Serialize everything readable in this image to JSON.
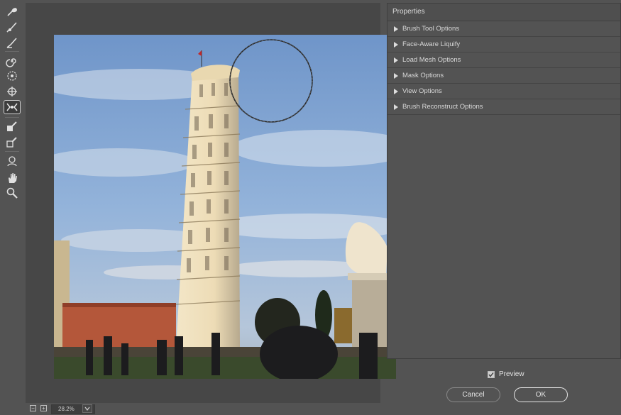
{
  "toolbar": {
    "tools": [
      {
        "name": "forward-warp-tool-icon"
      },
      {
        "name": "reconstruct-tool-icon"
      },
      {
        "name": "smooth-tool-icon"
      },
      {
        "name": "twirl-clockwise-tool-icon"
      },
      {
        "name": "pucker-tool-icon"
      },
      {
        "name": "bloat-tool-icon"
      },
      {
        "name": "push-left-tool-icon",
        "active": true
      },
      {
        "name": "freeze-mask-tool-icon"
      },
      {
        "name": "thaw-mask-tool-icon"
      },
      {
        "name": "face-tool-icon"
      },
      {
        "name": "hand-tool-icon"
      },
      {
        "name": "zoom-tool-icon"
      }
    ]
  },
  "properties": {
    "title": "Properties",
    "sections": [
      {
        "label": "Brush Tool Options"
      },
      {
        "label": "Face-Aware Liquify"
      },
      {
        "label": "Load Mesh Options"
      },
      {
        "label": "Mask Options"
      },
      {
        "label": "View Options"
      },
      {
        "label": "Brush Reconstruct Options"
      }
    ]
  },
  "preview": {
    "label": "Preview",
    "checked": true
  },
  "buttons": {
    "cancel": "Cancel",
    "ok": "OK"
  },
  "status": {
    "zoom": "28.2%",
    "zoom_out_glyph": "−",
    "zoom_in_glyph": "+"
  },
  "colors": {
    "accent_active": "#cfcfcf",
    "panel_bg": "#535353",
    "canvas_bg": "#474747"
  }
}
